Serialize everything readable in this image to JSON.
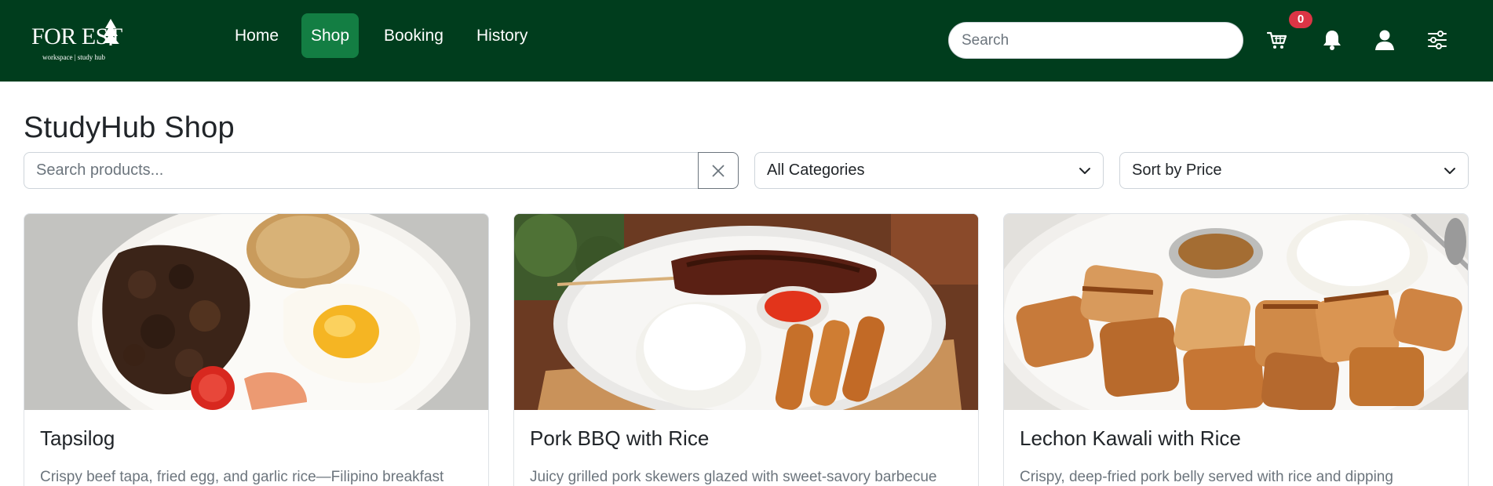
{
  "brand": {
    "name": "FOR EST",
    "tagline": "workspace | study hub"
  },
  "nav": {
    "items": [
      {
        "label": "Home",
        "active": false
      },
      {
        "label": "Shop",
        "active": true
      },
      {
        "label": "Booking",
        "active": false
      },
      {
        "label": "History",
        "active": false
      }
    ],
    "search_placeholder": "Search",
    "cart_count": "0",
    "icons": [
      "cart-icon",
      "bell-icon",
      "user-icon",
      "settings-sliders-icon"
    ]
  },
  "page": {
    "title": "StudyHub Shop",
    "product_search_placeholder": "Search products...",
    "category_select": {
      "selected": "All Categories"
    },
    "sort_select": {
      "selected": "Sort by Price"
    }
  },
  "products": [
    {
      "name": "Tapsilog",
      "description": "Crispy beef tapa, fried egg, and garlic rice—Filipino breakfast"
    },
    {
      "name": "Pork BBQ with Rice",
      "description": "Juicy grilled pork skewers glazed with sweet-savory barbecue"
    },
    {
      "name": "Lechon Kawali with Rice",
      "description": "Crispy, deep-fried pork belly served with rice and dipping"
    }
  ],
  "colors": {
    "navbar_bg": "#003d1d",
    "active_nav_bg": "#137e43",
    "badge_bg": "#dc3545"
  }
}
